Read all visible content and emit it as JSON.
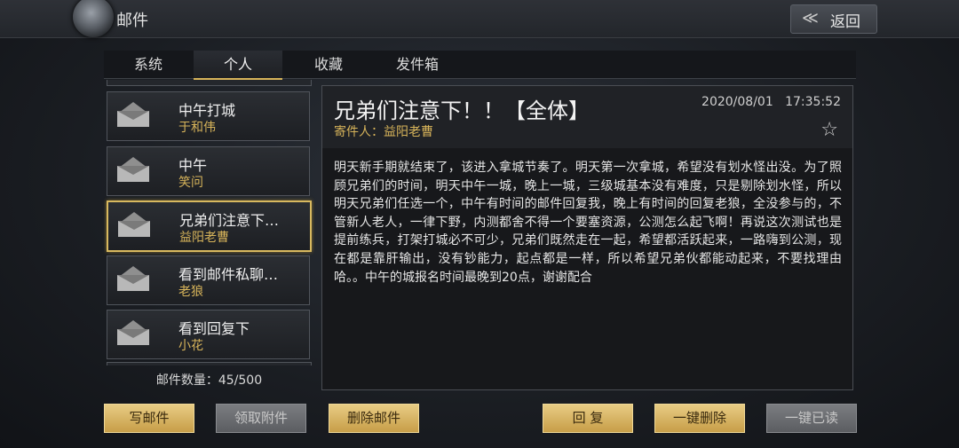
{
  "header": {
    "title": "邮件",
    "back_label": "返回"
  },
  "tabs": [
    "系统",
    "个人",
    "收藏",
    "发件箱"
  ],
  "active_tab": "个人",
  "mail_list": [
    {
      "title": "中午打城",
      "sender": "于和伟"
    },
    {
      "title": "中午",
      "sender": "笑问"
    },
    {
      "title": "兄弟们注意下…",
      "sender": "益阳老曹"
    },
    {
      "title": "看到邮件私聊…",
      "sender": "老狼"
    },
    {
      "title": "看到回复下",
      "sender": "小花"
    }
  ],
  "mail_count_label": "邮件数量：",
  "mail_count": "45/500",
  "mail": {
    "subject": "兄弟们注意下！！【全体】",
    "sender_label": "寄件人：",
    "sender": "益阳老曹",
    "date": "2020/08/01",
    "time": "17:35:52",
    "body": "明天新手期就结束了，该进入拿城节奏了。明天第一次拿城，希望没有划水怪出没。为了照顾兄弟们的时间，明天中午一城，晚上一城，三级城基本没有难度，只是剔除划水怪，所以明天兄弟们任选一个，中午有时间的邮件回复我，晚上有时间的回复老狼，全没参与的，不管新人老人，一律下野，内测都舍不得一个要塞资源，公测怎么起飞啊！再说这次测试也是提前练兵，打架打城必不可少，兄弟们既然走在一起，希望都活跃起来，一路嗨到公测，现在都是靠肝输出，没有钞能力，起点都是一样，所以希望兄弟伙都能动起来，不要找理由哈。。中午的城报名时间最晚到20点，谢谢配合"
  },
  "buttons": {
    "compose": "写邮件",
    "claim": "领取附件",
    "delete": "删除邮件",
    "reply": "回 复",
    "delete_all": "一键删除",
    "read_all": "一键已读"
  },
  "icons": {
    "back": "back-arrow-icon",
    "envelope": "envelope-icon",
    "favorite": "star-icon"
  },
  "colors": {
    "accent": "#d7b45a",
    "gold_button": "#e0c27a",
    "disabled_button": "#6b6d71"
  }
}
